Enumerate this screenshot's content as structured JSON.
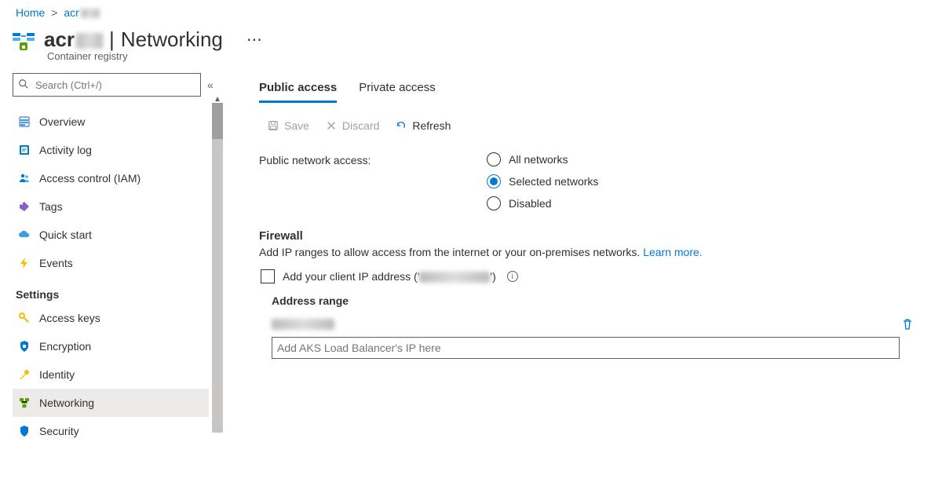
{
  "breadcrumb": {
    "home": "Home",
    "current": "acr"
  },
  "title": {
    "resource": "acr",
    "page": "Networking",
    "subtitle": "Container registry"
  },
  "search": {
    "placeholder": "Search (Ctrl+/)"
  },
  "nav": {
    "items_top": [
      {
        "id": "overview",
        "label": "Overview"
      },
      {
        "id": "activity-log",
        "label": "Activity log"
      },
      {
        "id": "iam",
        "label": "Access control (IAM)"
      },
      {
        "id": "tags",
        "label": "Tags"
      },
      {
        "id": "quick-start",
        "label": "Quick start"
      },
      {
        "id": "events",
        "label": "Events"
      }
    ],
    "settings_header": "Settings",
    "items_settings": [
      {
        "id": "access-keys",
        "label": "Access keys"
      },
      {
        "id": "encryption",
        "label": "Encryption"
      },
      {
        "id": "identity",
        "label": "Identity"
      },
      {
        "id": "networking",
        "label": "Networking",
        "active": true
      },
      {
        "id": "security",
        "label": "Security"
      }
    ]
  },
  "tabs": {
    "public": "Public access",
    "private": "Private access",
    "active": "public"
  },
  "toolbar": {
    "save": "Save",
    "discard": "Discard",
    "refresh": "Refresh"
  },
  "public_access": {
    "label": "Public network access:",
    "options": {
      "all": "All networks",
      "selected": "Selected networks",
      "disabled": "Disabled"
    },
    "value": "selected"
  },
  "firewall": {
    "title": "Firewall",
    "desc_prefix": "Add IP ranges to allow access from the internet or your on-premises networks. ",
    "learn_more": "Learn more.",
    "client_ip_label_prefix": "Add your client IP address ('",
    "client_ip_label_suffix": "')",
    "column_header": "Address range",
    "existing_value_masked": "xx.x.x.x",
    "new_placeholder": "Add AKS Load Balancer's IP here"
  }
}
